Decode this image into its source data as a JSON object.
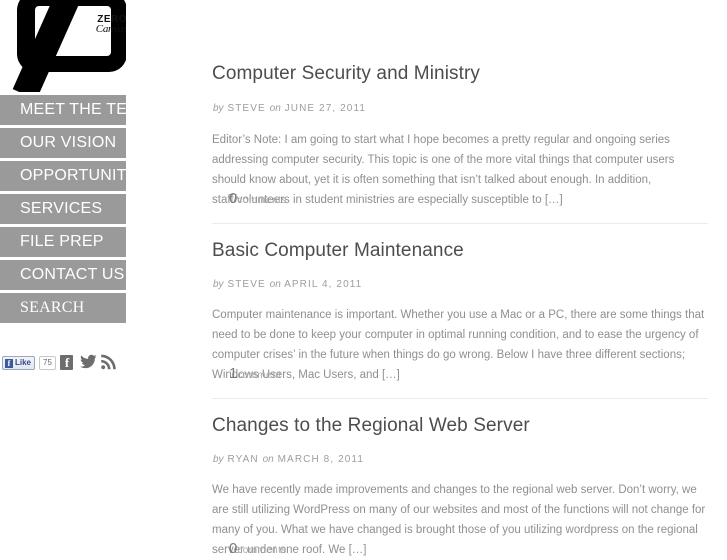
{
  "logo": {
    "zero_text": "ZERO",
    "canvas_text": "Canvas"
  },
  "nav": {
    "items": [
      {
        "label": "MEET THE TEAM",
        "style": "sans"
      },
      {
        "label": "OUR VISION",
        "style": "sans"
      },
      {
        "label": "OPPORTUNITIES",
        "style": "sans"
      },
      {
        "label": "SERVICES",
        "style": "sans"
      },
      {
        "label": "FILE PREP",
        "style": "sans"
      },
      {
        "label": "CONTACT US",
        "style": "sans"
      },
      {
        "label": "SEARCH",
        "style": "serif"
      }
    ]
  },
  "social": {
    "facebook_like_label": "Like",
    "facebook_like_count": "75",
    "facebook_icon_label": "f",
    "icons": [
      "facebook-icon",
      "twitter-icon",
      "rss-icon"
    ]
  },
  "posts": [
    {
      "title": "Computer Security and Ministry",
      "by_word": "by",
      "author": "STEVE",
      "on_word": "on",
      "date": "JUNE 27, 2011",
      "excerpt": "Editor’s Note: I am going to start what I hope becomes a pretty regular and ongoing series addressing computer security. This topic is one of the more vital things that computer users should know about, yet it is often something that isn’t talked about enough. In addition, staff/volunteers in student ministries are especially susceptible to […]",
      "comment_count": "0",
      "comment_label": "comments"
    },
    {
      "title": "Basic Computer Maintenance",
      "by_word": "by",
      "author": "STEVE",
      "on_word": "on",
      "date": "APRIL 4, 2011",
      "excerpt": "Computer maintenance is important. Whether you use a Mac or a PC, there are some things that need to be done to keep your computer in optimal running condition, and to ease the urgency of computer crises’ in the future when things do go wrong. Below I have three different sections; Windows Users, Mac Users, and […]",
      "comment_count": "1",
      "comment_label": "comment"
    },
    {
      "title": "Changes to the Regional Web Server",
      "by_word": "by",
      "author": "RYAN",
      "on_word": "on",
      "date": "MARCH 8, 2011",
      "excerpt": "We have recently made improvements and changes to the regional web server. Don’t worry, we are still utilizing WordPress on many of our websites and most of the functions will not change for many of you. What we have changed is brought those of you utilizing wordpress on the regional server under one roof. We […]",
      "comment_count": "0",
      "comment_label": "comments"
    }
  ],
  "colors": {
    "nav_background": "#9a9a9a",
    "nav_text": "#ffffff",
    "title_text": "#4d4d4d",
    "body_text": "#8f8f8f",
    "meta_text": "#9d9d9d",
    "divider": "#ebebeb"
  }
}
